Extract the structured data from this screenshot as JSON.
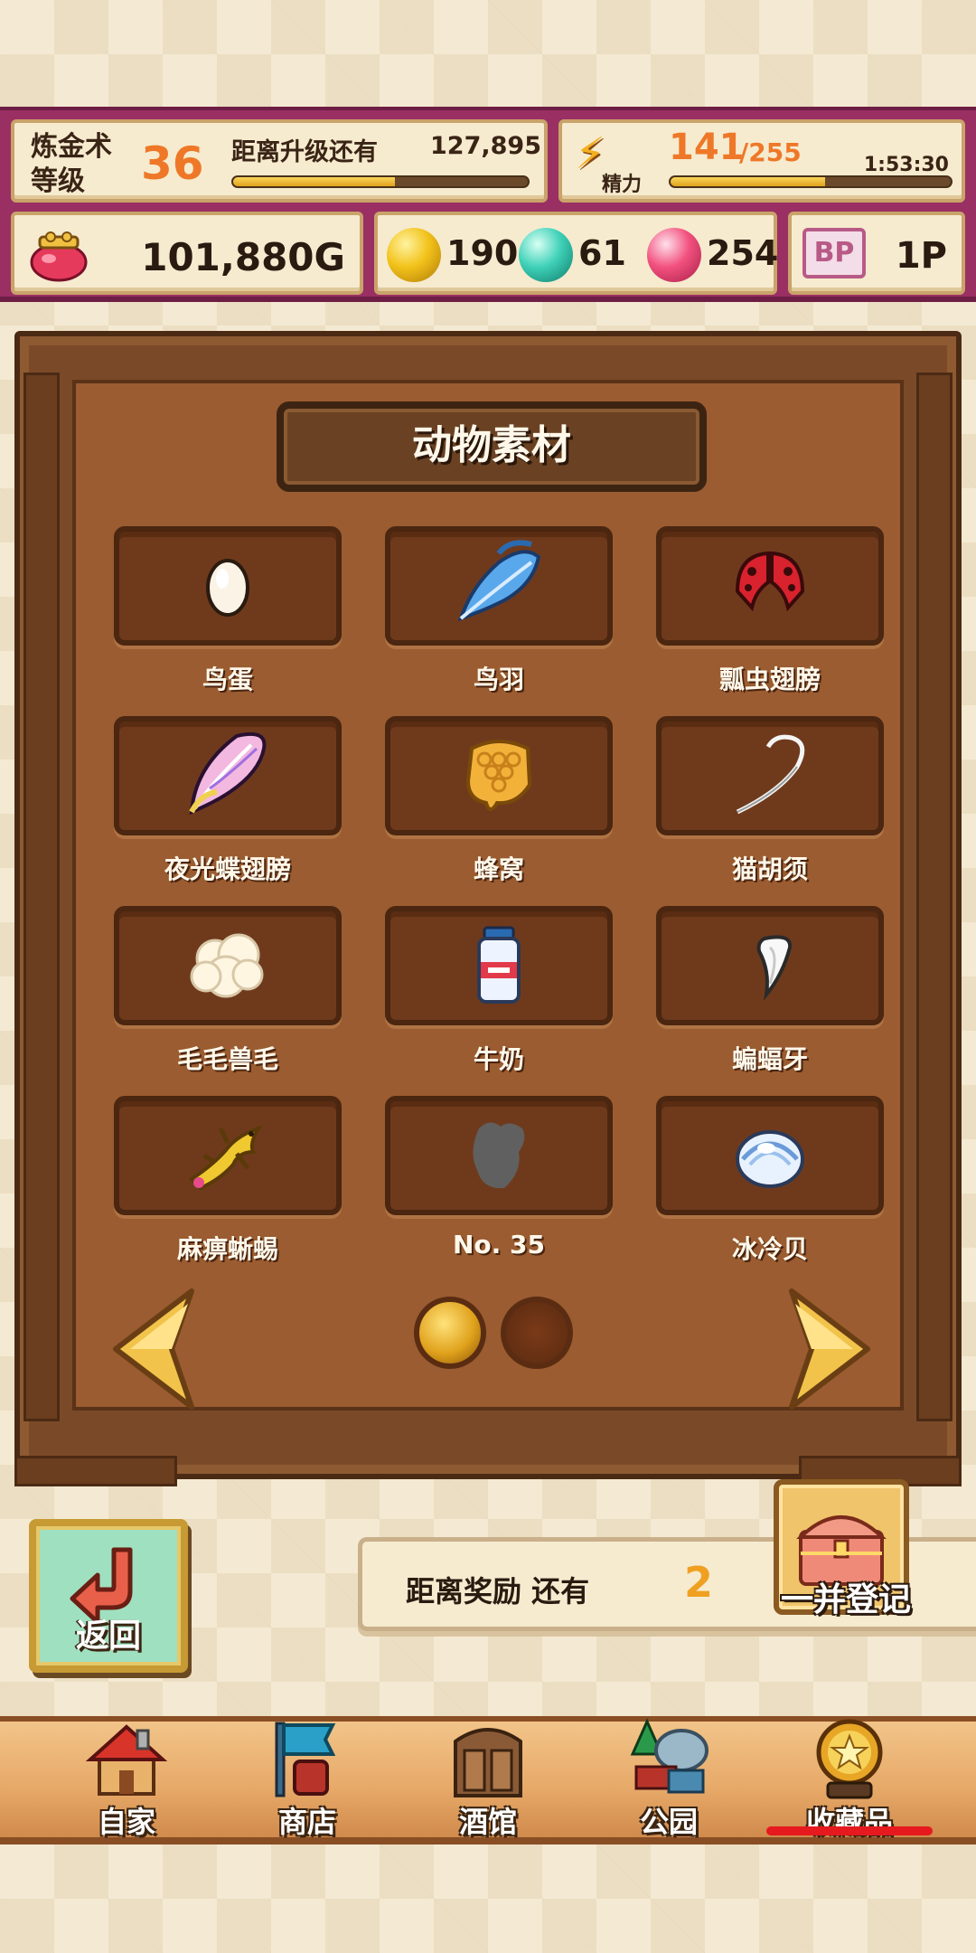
{
  "status": {
    "alchemy_label": "炼金术等级",
    "alchemy_level": "36",
    "next_level_label": "距离升级还有",
    "next_level_value": "127,895",
    "xp_progress": 0.55,
    "energy_label": "精力",
    "energy_current": "141",
    "energy_max": "/255",
    "energy_timer": "1:53:30",
    "energy_progress": 0.55,
    "gold": "101,880G",
    "yellow_orbs": "190",
    "teal_orbs": "61",
    "pink_orbs": "254",
    "bp_icon": "BP",
    "bp_value": "1P"
  },
  "cabinet": {
    "title": "动物素材",
    "items": [
      {
        "name": "鸟蛋",
        "icon": "egg-icon"
      },
      {
        "name": "鸟羽",
        "icon": "feather-icon"
      },
      {
        "name": "瓢虫翅膀",
        "icon": "ladybug-wing-icon"
      },
      {
        "name": "夜光蝶翅膀",
        "icon": "butterfly-wing-icon"
      },
      {
        "name": "蜂窝",
        "icon": "honeycomb-icon"
      },
      {
        "name": "猫胡须",
        "icon": "whisker-icon"
      },
      {
        "name": "毛毛兽毛",
        "icon": "fur-icon"
      },
      {
        "name": "牛奶",
        "icon": "milk-icon"
      },
      {
        "name": "蝙蝠牙",
        "icon": "fang-icon"
      },
      {
        "name": "麻痹蜥蜴",
        "icon": "lizard-icon"
      },
      {
        "name": "No. 35",
        "icon": "unknown-silhouette-icon"
      },
      {
        "name": "冰冷贝",
        "icon": "shell-icon"
      }
    ],
    "page_current": 1,
    "page_total": 2
  },
  "actions": {
    "back_label": "返回",
    "reward_label": "距离奖励 还有",
    "reward_count": "2",
    "register_label": "一并登记"
  },
  "nav": {
    "items": [
      {
        "label": "自家",
        "icon": "house-icon"
      },
      {
        "label": "商店",
        "icon": "shop-icon"
      },
      {
        "label": "酒馆",
        "icon": "tavern-icon"
      },
      {
        "label": "公园",
        "icon": "park-icon"
      },
      {
        "label": "收藏品",
        "icon": "collection-medal-icon"
      }
    ],
    "active": "收藏品",
    "active_color": "#e6191f"
  }
}
